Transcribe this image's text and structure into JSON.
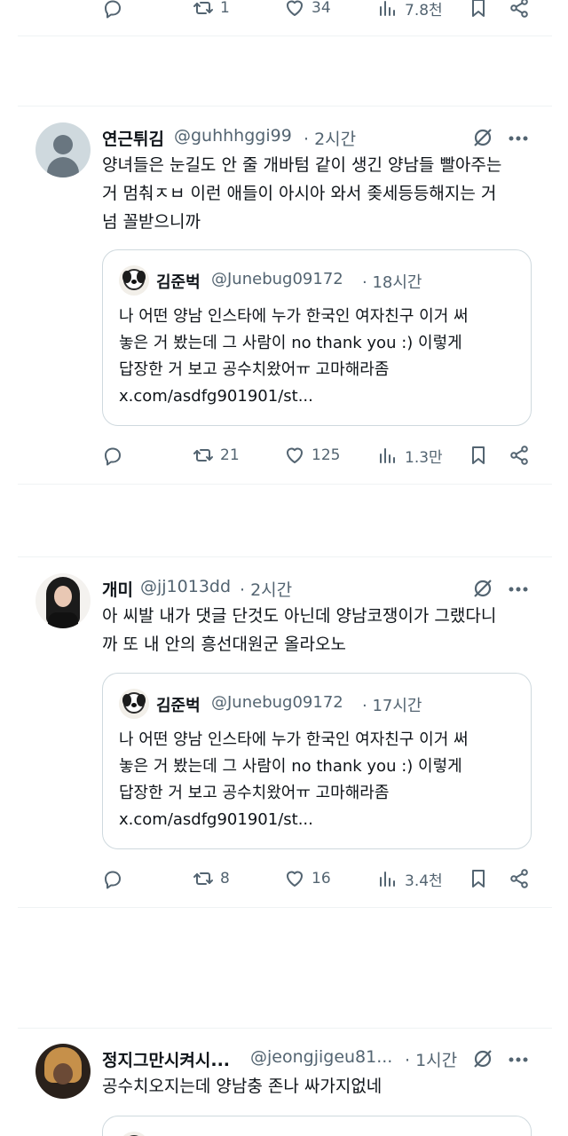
{
  "top_actions": {
    "retweets": "1",
    "likes": "34",
    "views": "7.8천"
  },
  "tweets": [
    {
      "author_name": "연근튀김",
      "handle": "@guhhhggi99",
      "time": "· 2시간",
      "lines": [
        "양녀들은 눈길도 안 줄 개바텀 같이 생긴 양남들 빨아주는",
        "거 멈춰ㅈㅂ 이런 애들이 아시아 와서 좆세등등해지는 거",
        "넘 꼴받으니까"
      ],
      "quote": {
        "name": "김준벅",
        "handle": "@Junebug09172",
        "time": "· 18시간",
        "lines": [
          "나 어떤 양남 인스타에 누가 한국인 여자친구 이거 써",
          "놓은 거 봤는데 그 사람이 no thank you :) 이렇게",
          "답장한 거 보고 공수치왔어ㅠ 고마해라좀",
          "x.com/asdfg901901/st..."
        ]
      },
      "retweets": "21",
      "likes": "125",
      "views": "1.3만"
    },
    {
      "author_name": "개미",
      "handle": "@jj1013dd",
      "time": "· 2시간",
      "lines": [
        "아 씨발 내가 댓글 단것도 아닌데 양남코쟁이가 그랬다니",
        "까 또 내 안의 흥선대원군 올라오노"
      ],
      "quote": {
        "name": "김준벅",
        "handle": "@Junebug09172",
        "time": "· 17시간",
        "lines": [
          "나 어떤 양남 인스타에 누가 한국인 여자친구 이거 써",
          "놓은 거 봤는데 그 사람이 no thank you :) 이렇게",
          "답장한 거 보고 공수치왔어ㅠ 고마해라좀",
          "x.com/asdfg901901/st..."
        ]
      },
      "retweets": "8",
      "likes": "16",
      "views": "3.4천"
    },
    {
      "author_name": "정지그만시켜시...",
      "handle": "@jeongjigeu81...",
      "time": "· 1시간",
      "lines": [
        "공수치오지는데 양남충 존나 싸가지없네"
      ]
    }
  ]
}
